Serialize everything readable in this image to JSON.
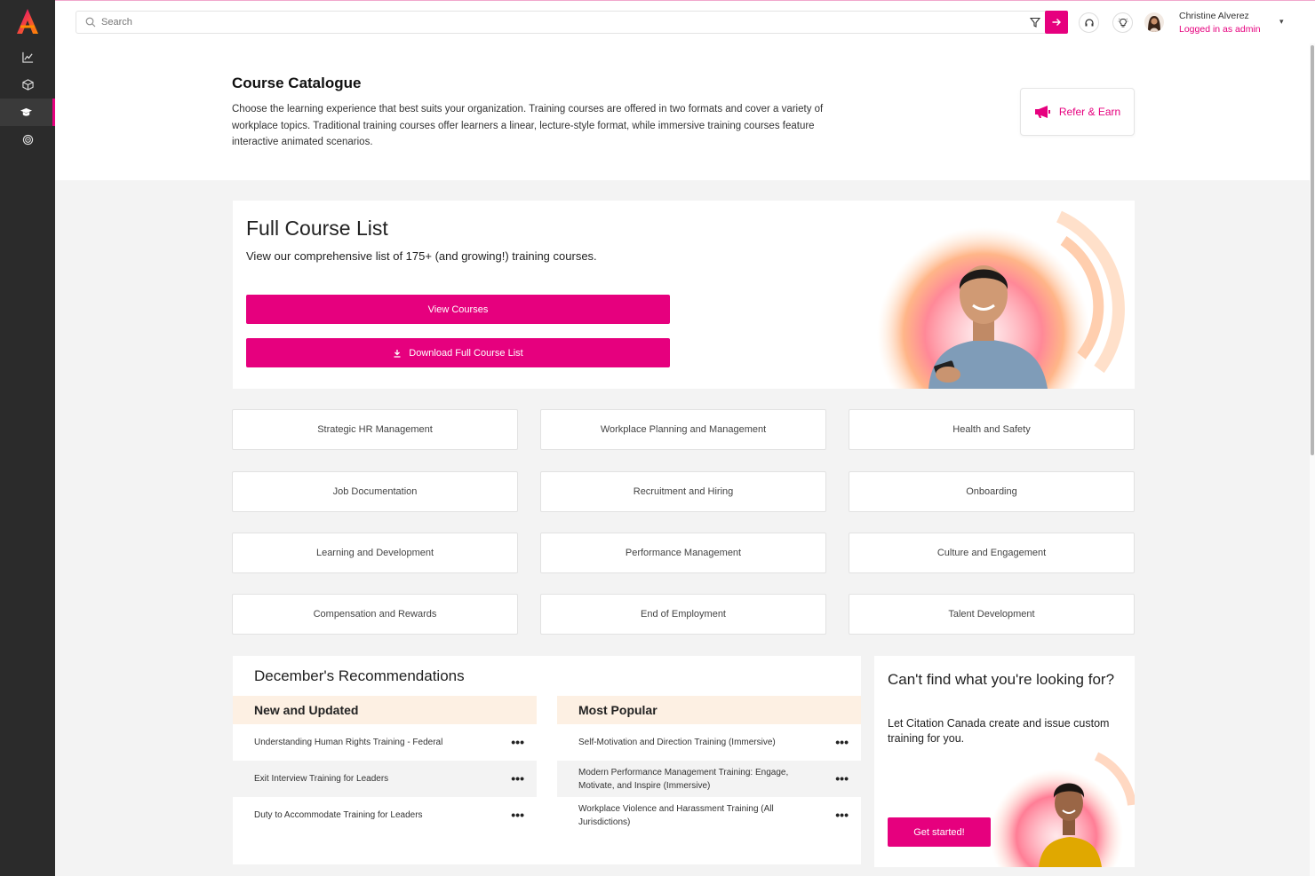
{
  "app": {
    "logo_icon": "a-logo-icon",
    "brand_color": "#e6007e",
    "sidebar_icons": [
      "chart-line-icon",
      "cube-icon",
      "graduation-cap-icon",
      "target-icon"
    ]
  },
  "topbar": {
    "search_placeholder": "Search",
    "filter_icon": "filter-icon",
    "go_icon": "arrow-right-icon",
    "support_icon": "headset-icon",
    "ideas_icon": "lightbulb-icon",
    "user_name": "Christine Alverez",
    "user_role": "Logged in as admin",
    "menu_caret": "▾"
  },
  "header": {
    "title": "Course Catalogue",
    "description": "Choose the learning experience that best suits your organization. Training courses are offered in two formats and cover a variety of workplace topics. Traditional training courses offer learners a linear, lecture-style format, while immersive training courses feature interactive animated scenarios.",
    "refer_label": "Refer & Earn",
    "refer_icon": "megaphone-icon"
  },
  "course_list": {
    "title": "Full Course List",
    "subtitle": "View our comprehensive list of 175+ (and growing!) training courses.",
    "view_label": "View Courses",
    "download_label": "Download Full Course List",
    "download_icon": "download-icon"
  },
  "categories": [
    "Strategic HR Management",
    "Workplace Planning and Management",
    "Health and Safety",
    "Job Documentation",
    "Recruitment and Hiring",
    "Onboarding",
    "Learning and Development",
    "Performance Management",
    "Culture and Engagement",
    "Compensation and Rewards",
    "End of Employment",
    "Talent Development"
  ],
  "recommendations": {
    "title": "December's Recommendations",
    "new_title": "New and Updated",
    "new_items": [
      "Understanding Human Rights Training - Federal",
      "Exit Interview Training for Leaders",
      "Duty to Accommodate Training for Leaders"
    ],
    "popular_title": "Most Popular",
    "popular_items": [
      "Self-Motivation and Direction Training (Immersive)",
      "Modern Performance Management Training: Engage, Motivate, and Inspire (Immersive)",
      "Workplace Violence and Harassment Training (All Jurisdictions)"
    ],
    "more_label": "•••"
  },
  "cta": {
    "title": "Can't find what you're looking for?",
    "subtitle": "Let Citation Canada create and issue custom training for you.",
    "button_label": "Get started!"
  }
}
